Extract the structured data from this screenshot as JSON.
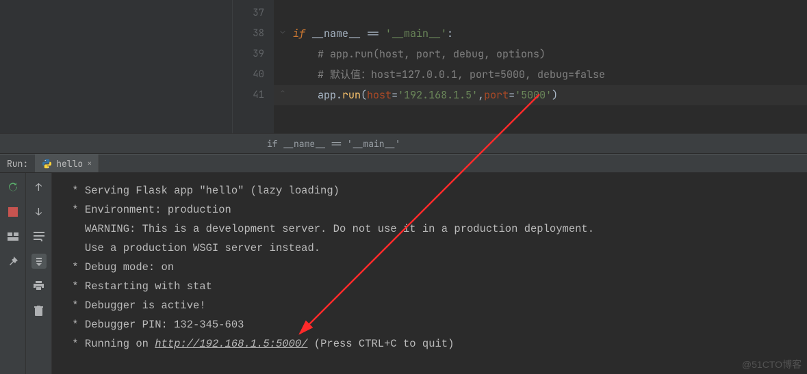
{
  "editor": {
    "lines": [
      {
        "num": "37",
        "html": ""
      },
      {
        "num": "38",
        "html": "<span class='kw'>if</span> __name__ == <span class='str'>'__main__'</span>:",
        "run": true,
        "fold": "down"
      },
      {
        "num": "39",
        "html": "    <span class='cmt'># app.run(host, port, debug, options)</span>"
      },
      {
        "num": "40",
        "html": "    <span class='cmt'># 默认值：host=127.0.0.1, port=5000, debug=false</span>"
      },
      {
        "num": "41",
        "html": "    app.<span class='fn'>run</span>(<span class='param'>host</span>=<span class='str'>'192.168.1.5'</span>,<span class='param'>port</span>=<span class='str'>'5000'</span>)",
        "hl": true,
        "fold": "up"
      },
      {
        "num": "",
        "html": ""
      }
    ]
  },
  "breadcrumb": "if __name__ == '__main__'",
  "run": {
    "label": "Run:",
    "tab": "hello",
    "lines": [
      " * Serving Flask app \"hello\" (lazy loading)",
      " * Environment: production",
      "   WARNING: This is a development server. Do not use it in a production deployment.",
      "   Use a production WSGI server instead.",
      " * Debug mode: on",
      " * Restarting with stat",
      " * Debugger is active!",
      " * Debugger PIN: 132-345-603",
      " * Running on <a href='#'>http://192.168.1.5:5000/</a> (Press CTRL+C to quit)"
    ]
  },
  "watermark": "@51CTO博客"
}
